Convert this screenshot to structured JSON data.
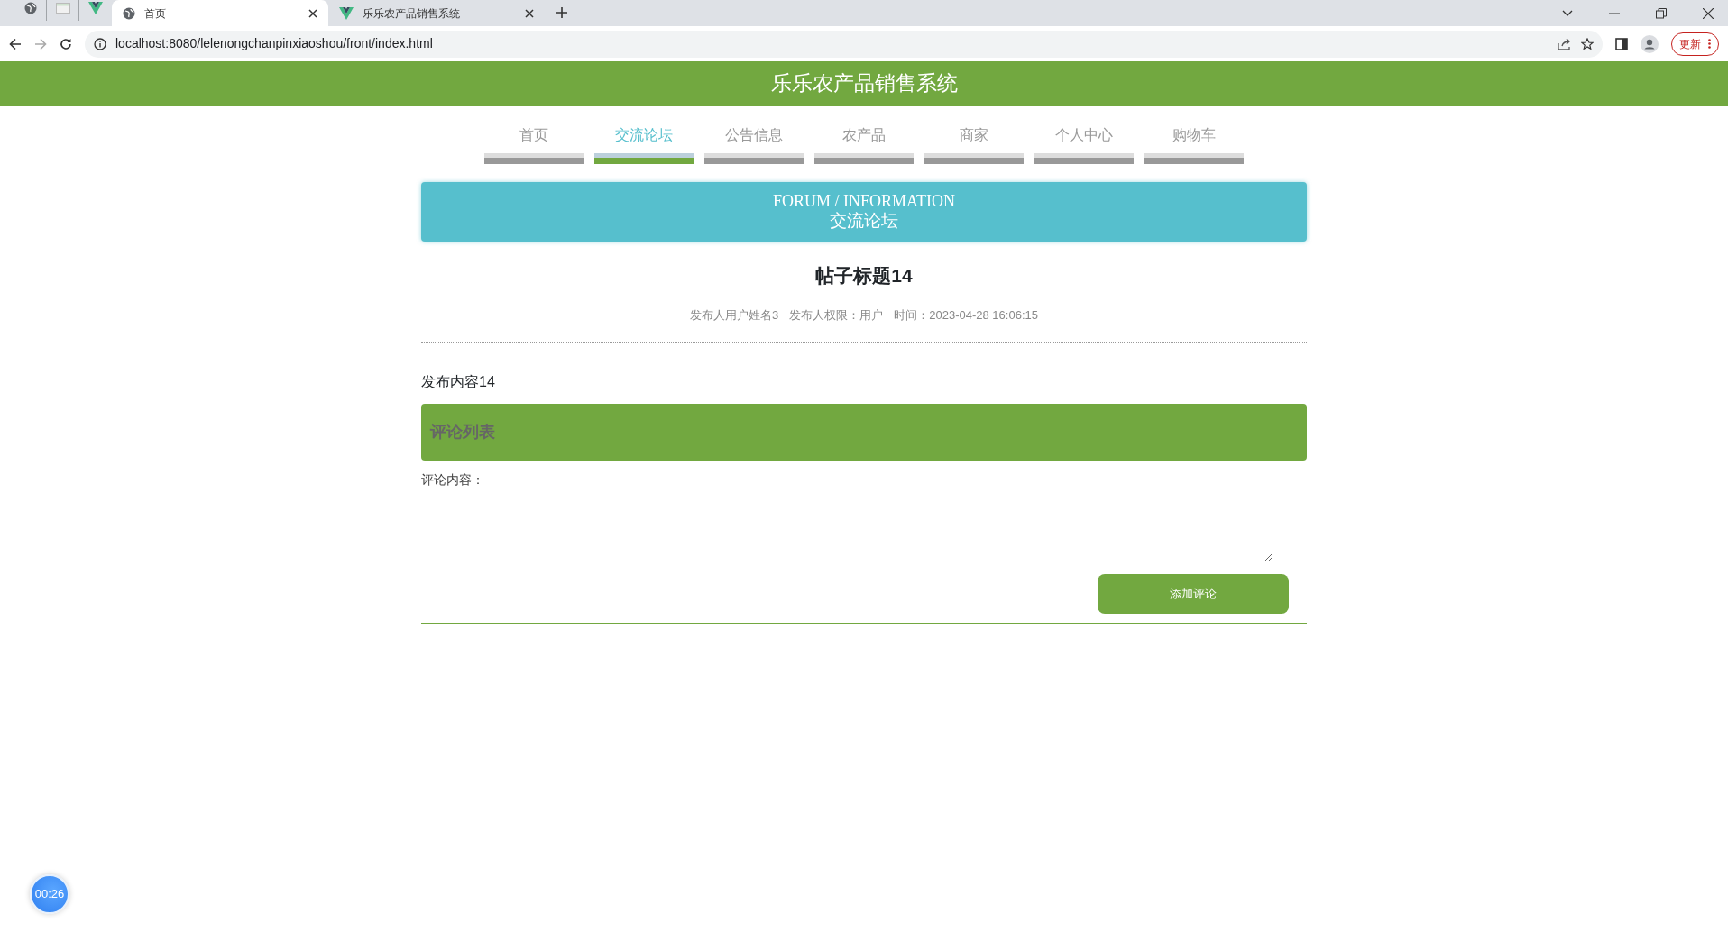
{
  "browser": {
    "tabs": [
      {
        "title": "首页",
        "selected": true,
        "kind": "page"
      },
      {
        "title": "乐乐农产品销售系统",
        "selected": false,
        "kind": "app"
      }
    ],
    "url": "localhost:8080/lelenongchanpinxiaoshou/front/index.html",
    "update_button": "更新"
  },
  "header": {
    "title": "乐乐农产品销售系统"
  },
  "nav": [
    {
      "label": "首页",
      "selected": false
    },
    {
      "label": "交流论坛",
      "selected": true
    },
    {
      "label": "公告信息",
      "selected": false
    },
    {
      "label": "农产品",
      "selected": false
    },
    {
      "label": "商家",
      "selected": false
    },
    {
      "label": "个人中心",
      "selected": false
    },
    {
      "label": "购物车",
      "selected": false
    }
  ],
  "banner": {
    "english": "FORUM / INFORMATION",
    "chinese": "交流论坛"
  },
  "post": {
    "title": "帖子标题14",
    "meta": [
      "发布人用户姓名3",
      "发布人权限：用户",
      "时间：2023-04-28 16:06:15"
    ],
    "content": "发布内容14"
  },
  "comments": {
    "heading": "评论列表",
    "label": "评论内容：",
    "submit": "添加评论"
  },
  "timer": "00:26"
}
